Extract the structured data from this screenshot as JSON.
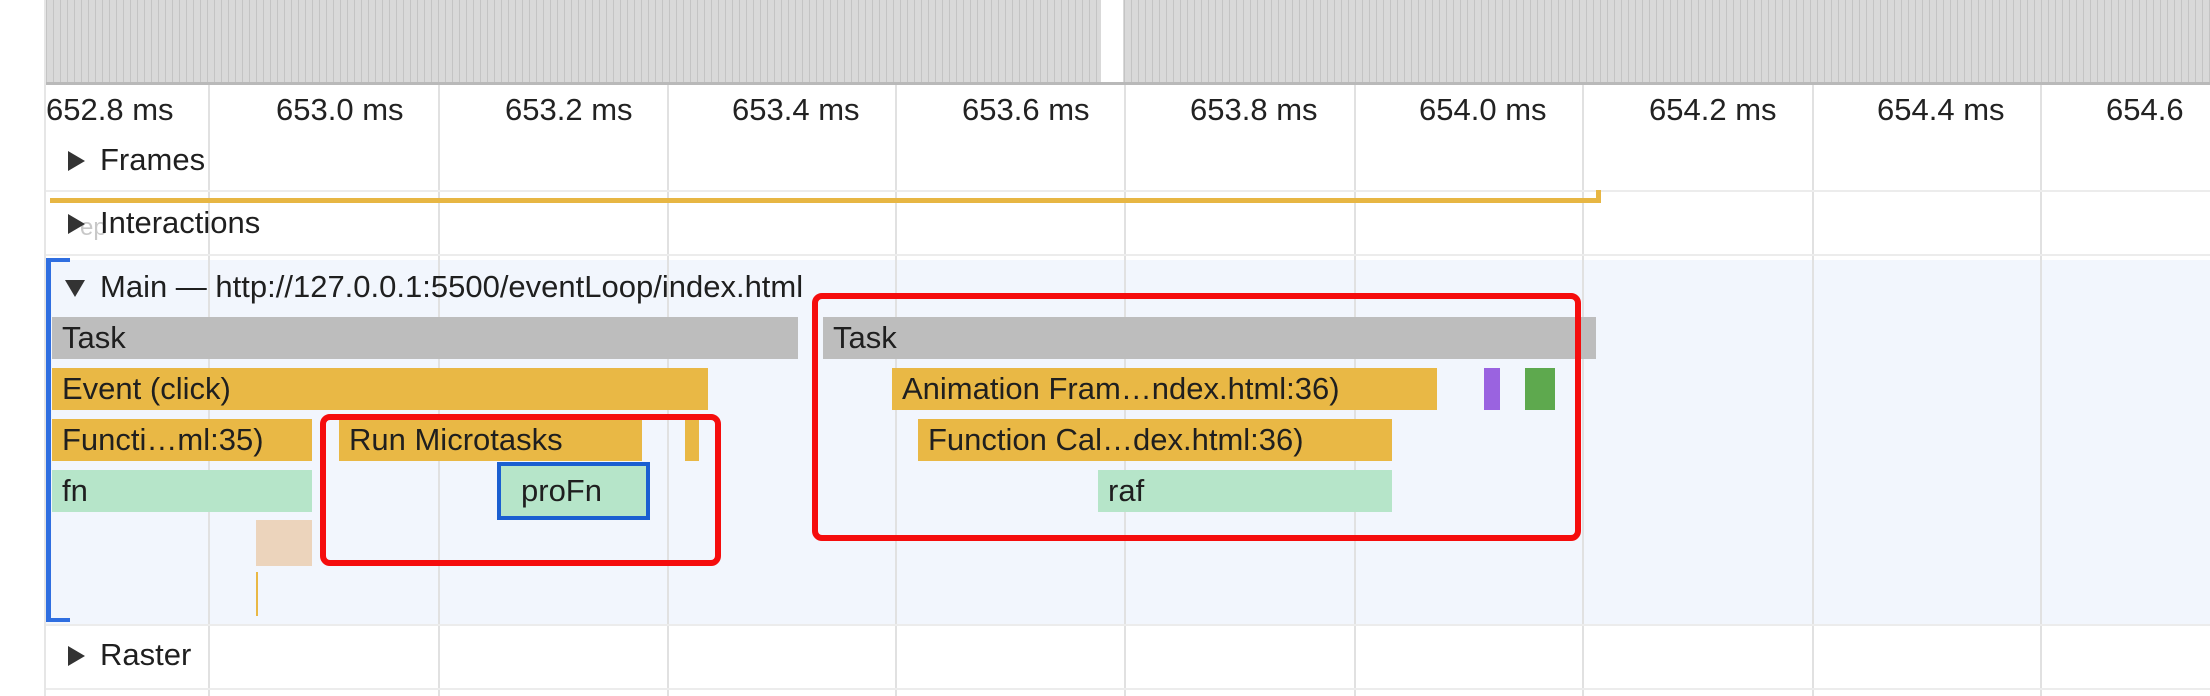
{
  "ruler": {
    "ticks": [
      "652.8 ms",
      "653.0 ms",
      "653.2 ms",
      "653.4 ms",
      "653.6 ms",
      "653.8 ms",
      "654.0 ms",
      "654.2 ms",
      "654.4 ms",
      "654.6"
    ]
  },
  "tracks": {
    "frames": "Frames",
    "interactions_ghost": "ep",
    "interactions": "Interactions",
    "main": "Main — http://127.0.0.1:5500/eventLoop/index.html",
    "raster": "Raster"
  },
  "flame": {
    "task_1": "Task",
    "task_2": "Task",
    "event_click": "Event (click)",
    "function_call_1": "Functi…ml:35)",
    "run_microtasks": "Run Microtasks",
    "fn": "fn",
    "profn": "proFn",
    "animation_frame": "Animation Fram…ndex.html:36)",
    "function_call_2": "Function Cal…dex.html:36)",
    "raf": "raf"
  },
  "colors": {
    "task": "#bdbdbd",
    "scripting": "#e9b845",
    "js_function": "#b6e5c9",
    "selection": "#1a5fd1",
    "annotation": "#f50d0d",
    "main_track": "#2f6ee0"
  }
}
